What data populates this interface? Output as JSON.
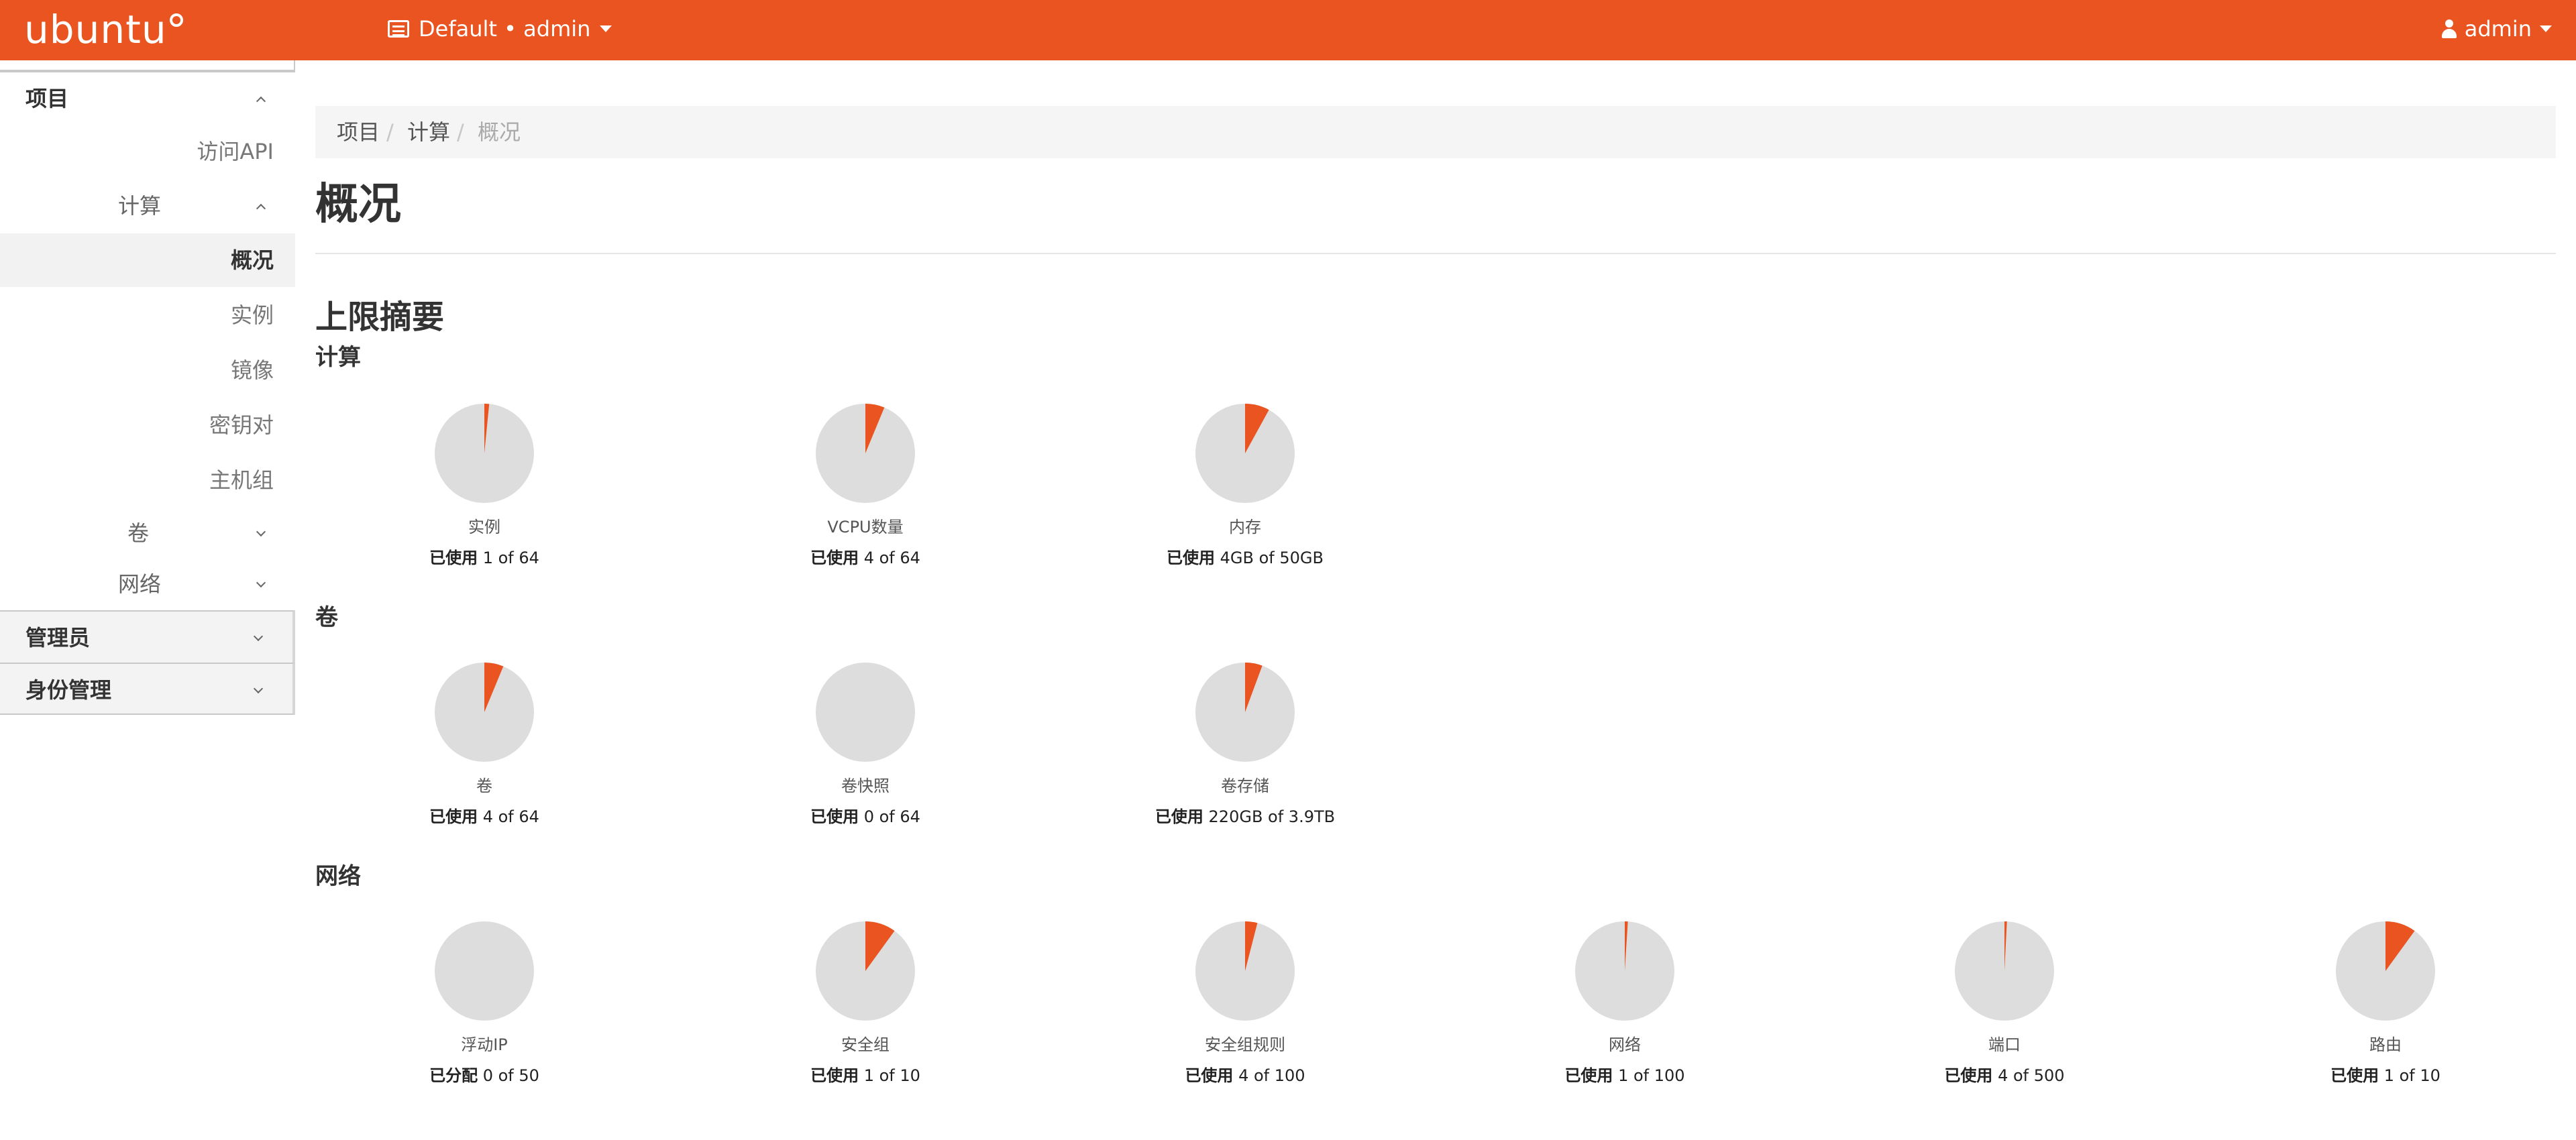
{
  "navbar": {
    "brand": "ubuntu",
    "project_label": "Default • admin",
    "user_label": "admin"
  },
  "sidebar": {
    "project_header": "项目",
    "api_access": "访问API",
    "compute_label": "计算",
    "compute_items": [
      "概况",
      "实例",
      "镜像",
      "密钥对",
      "主机组"
    ],
    "volumes_label": "卷",
    "network_label": "网络",
    "admin_header": "管理员",
    "identity_header": "身份管理"
  },
  "breadcrumb": {
    "items": [
      "项目",
      "计算",
      "概况"
    ]
  },
  "page": {
    "title": "概况",
    "summary_title": "上限摘要",
    "sections": [
      "计算",
      "卷",
      "网络"
    ]
  },
  "quotas": {
    "compute": [
      {
        "label": "实例",
        "prefix": "已使用",
        "detail": "1 of 64",
        "used": 1,
        "total": 64
      },
      {
        "label": "VCPU数量",
        "prefix": "已使用",
        "detail": "4 of 64",
        "used": 4,
        "total": 64
      },
      {
        "label": "内存",
        "prefix": "已使用",
        "detail": "4GB of 50GB",
        "used": 4,
        "total": 50
      }
    ],
    "volume": [
      {
        "label": "卷",
        "prefix": "已使用",
        "detail": "4 of 64",
        "used": 4,
        "total": 64
      },
      {
        "label": "卷快照",
        "prefix": "已使用",
        "detail": "0 of 64",
        "used": 0,
        "total": 64
      },
      {
        "label": "卷存储",
        "prefix": "已使用",
        "detail": "220GB of 3.9TB",
        "used": 220,
        "total": 3900
      }
    ],
    "network": [
      {
        "label": "浮动IP",
        "prefix": "已分配",
        "detail": "0 of 50",
        "used": 0,
        "total": 50
      },
      {
        "label": "安全组",
        "prefix": "已使用",
        "detail": "1 of 10",
        "used": 1,
        "total": 10
      },
      {
        "label": "安全组规则",
        "prefix": "已使用",
        "detail": "4 of 100",
        "used": 4,
        "total": 100
      },
      {
        "label": "网络",
        "prefix": "已使用",
        "detail": "1 of 100",
        "used": 1,
        "total": 100
      },
      {
        "label": "端口",
        "prefix": "已使用",
        "detail": "4 of 500",
        "used": 4,
        "total": 500
      },
      {
        "label": "路由",
        "prefix": "已使用",
        "detail": "1 of 10",
        "used": 1,
        "total": 10
      }
    ]
  },
  "colors": {
    "accent": "#e95420",
    "pie_background": "#dddddd"
  }
}
